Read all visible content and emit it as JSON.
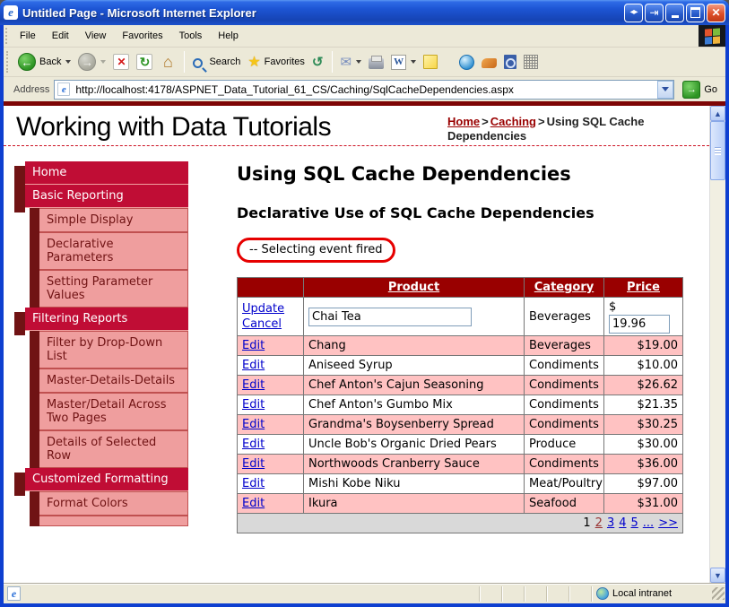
{
  "window": {
    "title": "Untitled Page - Microsoft Internet Explorer"
  },
  "menu": {
    "items": [
      "File",
      "Edit",
      "View",
      "Favorites",
      "Tools",
      "Help"
    ]
  },
  "toolbar": {
    "back": "Back",
    "search": "Search",
    "favorites": "Favorites"
  },
  "address": {
    "label": "Address",
    "url": "http://localhost:4178/ASPNET_Data_Tutorial_61_CS/Caching/SqlCacheDependencies.aspx",
    "go": "Go"
  },
  "page": {
    "site_title": "Working with Data Tutorials",
    "breadcrumb": {
      "home": "Home",
      "section": "Caching",
      "separator": ">",
      "current": "Using SQL Cache Dependencies"
    },
    "sidebar": {
      "items": [
        {
          "label": "Home",
          "type": "primary"
        },
        {
          "label": "Basic Reporting",
          "type": "primary"
        },
        {
          "label": "Simple Display",
          "type": "sub"
        },
        {
          "label": "Declarative Parameters",
          "type": "sub"
        },
        {
          "label": "Setting Parameter Values",
          "type": "sub"
        },
        {
          "label": "Filtering Reports",
          "type": "primary"
        },
        {
          "label": "Filter by Drop-Down List",
          "type": "sub"
        },
        {
          "label": "Master-Details-Details",
          "type": "sub"
        },
        {
          "label": "Master/Detail Across Two Pages",
          "type": "sub"
        },
        {
          "label": "Details of Selected Row",
          "type": "sub"
        },
        {
          "label": "Customized Formatting",
          "type": "primary"
        },
        {
          "label": "Format Colors",
          "type": "sub"
        }
      ]
    },
    "main": {
      "heading": "Using SQL Cache Dependencies",
      "subheading": "Declarative Use of SQL Cache Dependencies",
      "status_message": "-- Selecting event fired",
      "grid": {
        "columns": [
          "Product",
          "Category",
          "Price"
        ],
        "edit_row": {
          "update": "Update",
          "cancel": "Cancel",
          "product": "Chai Tea",
          "category": "Beverages",
          "currency": "$",
          "price": "19.96"
        },
        "rows": [
          {
            "action": "Edit",
            "product": "Chang",
            "category": "Beverages",
            "price": "$19.00"
          },
          {
            "action": "Edit",
            "product": "Aniseed Syrup",
            "category": "Condiments",
            "price": "$10.00"
          },
          {
            "action": "Edit",
            "product": "Chef Anton's Cajun Seasoning",
            "category": "Condiments",
            "price": "$26.62"
          },
          {
            "action": "Edit",
            "product": "Chef Anton's Gumbo Mix",
            "category": "Condiments",
            "price": "$21.35"
          },
          {
            "action": "Edit",
            "product": "Grandma's Boysenberry Spread",
            "category": "Condiments",
            "price": "$30.25"
          },
          {
            "action": "Edit",
            "product": "Uncle Bob's Organic Dried Pears",
            "category": "Produce",
            "price": "$30.00"
          },
          {
            "action": "Edit",
            "product": "Northwoods Cranberry Sauce",
            "category": "Condiments",
            "price": "$36.00"
          },
          {
            "action": "Edit",
            "product": "Mishi Kobe Niku",
            "category": "Meat/Poultry",
            "price": "$97.00"
          },
          {
            "action": "Edit",
            "product": "Ikura",
            "category": "Seafood",
            "price": "$31.00"
          }
        ],
        "pager": {
          "current": "1",
          "links": [
            {
              "label": "2",
              "visited": true
            },
            {
              "label": "3"
            },
            {
              "label": "4"
            },
            {
              "label": "5"
            },
            {
              "label": "..."
            },
            {
              "label": ">>"
            }
          ]
        }
      }
    }
  },
  "statusbar": {
    "zone": "Local intranet"
  },
  "colors": {
    "titlebar_blue": "#1D55D4",
    "window_border_blue": "#0E3FD0",
    "chrome_beige": "#ECE9D8",
    "maroon_bar": "#7E0505",
    "grid_header_maroon": "#990000",
    "grid_row_pink": "#FFC2C2",
    "pager_gray": "#D9D9D9",
    "sidebar_crimson": "#C00D35",
    "sidebar_dark_maroon": "#701314",
    "sidebar_pink": "#EF9E9E",
    "link_blue": "#0000CC",
    "breadcrumb_link_maroon": "#990000",
    "annotation_red": "#E60000"
  }
}
